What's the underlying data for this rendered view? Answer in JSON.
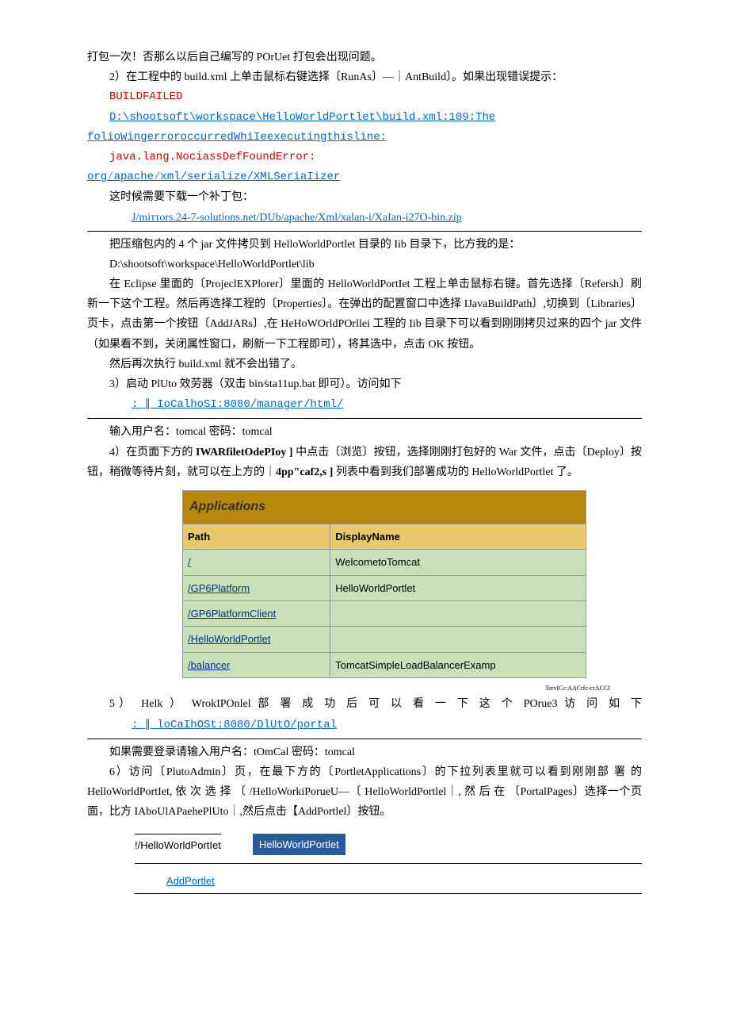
{
  "p1": "打包一次！否那么以后自己编写的 POrUet 打包会出现问题。",
  "p2": "2）在工程中的 build.xml 上单击鼠标右键选择〔RunAs〕—｜AntBuild〕。如果出现错误提示：",
  "err1": "BUILDFAILED",
  "err2a": "D:\\shootsoft\\workspace\\HelloWorldPortlet\\build.xml:109:The",
  "err2b": "folioWingerroroccurredWhiIeexecutingthisline:",
  "err3": "java.lang.NociassDefFoundError:",
  "err4": "org∕apache∕xml/serialize/XMLSeriaIizer",
  "p3": "这时候需要下载一个补丁包：",
  "link1": "J/miττors.24-7-solutions.net/DUb/apache/Xml/xalan-i/XaIan-i27O-bin.zip",
  "p4": "把压缩包内的 4 个 jar 文件拷贝到 HelloWorldPortlet 目录的 Iib 目录下，比方我的是：",
  "p5": "D:\\shootsoft\\workspace\\HelloWorldPortlet\\lib",
  "p6": "在 Eclipse 里面的〔ProjeclEXPlorer〕里面的 HelloWorldPortIet 工程上单击鼠标右键。首先选择〔Refersh〕刷新一下这个工程。然后再选择工程的〔Properties〕。在弹出的配置窗口中选择 IJavaBuildPath〕,切换到〔Libraries〕页卡，点击第一个按钮〔AddJARs〕,在 HeHoWOrldPOrllei 工程的 Iib 目录下可以看到刚刚拷贝过来的四个 jar 文件（如果看不到，关闭属性窗口，刷新一下工程即可），将其选中，点击 OK 按钮。",
  "p7": "然后再次执行 build.xml 就不会出错了。",
  "p8": "3）启动 PlUto 效劳器（双击 bin∕sta11up.bat 即可）。访问如下",
  "link2": ": ∥ IoCalhoSI:8080/manager/html/",
  "p9": "输入用户名：tomcal 密码：tomcal",
  "p10a": "4）在页面下方的 ",
  "p10b": "IWARfiletOdePIoy ]",
  "p10c": " 中点击〔浏览〕按钮，选择刚刚打包好的 War 文件，点击〔Deploy〕按钮，稍微等待片刻，就可以在上方的｜",
  "p10d": "4pp\"caf2,s ]",
  "p10e": " 列表中看到我们部署成功的 HelloWorldPortlet 了。",
  "table": {
    "title": "Applications",
    "h1": "Path",
    "h2": "DisplayName",
    "rows": [
      {
        "path": "/",
        "name": "WelcometoTomcat"
      },
      {
        "path": "/GP6Platform",
        "name": "HelloWorldPortlet"
      },
      {
        "path": "/GP6PlatformClient",
        "name": ""
      },
      {
        "path": "/HelloWorldPortlet",
        "name": ""
      },
      {
        "path": "/balancer",
        "name": "TomcatSimpleLoadBalancerExamp"
      }
    ],
    "caption": "TervICc:AACrfc-crACCI"
  },
  "p11a": "5） Helk ） WrokIPOnlel 部 署 成 功 后 可 以 看 一 下 这 个 POrue3 访 问 如 下",
  "link3": ": ∥ loCaIhOSt:8080/DlUtO/portal",
  "p12": "如果需要登录请输入用户名：tOmCal 密码：tomcal",
  "p13": "6）访问〔PlutoAdmin〕页，在最下方的〔PortletApplications〕的下拉列表里就可以看到刚刚部 署 的 HelloWorldPortIet, 依 次 选 择 〔 /HelloWorkiPorueU—〔 HelloWorldPortlel｜, 然 后 在 〔PortalPages〕选择一个页面，比方 IAboUlAPaehePlUto｜,然后点击【AddPortlel〕按钮。",
  "portlet": {
    "dropdown": "!/HelloWorldPortIet",
    "selected": "HelloWorldPortlet",
    "add": "AddPortlet"
  }
}
